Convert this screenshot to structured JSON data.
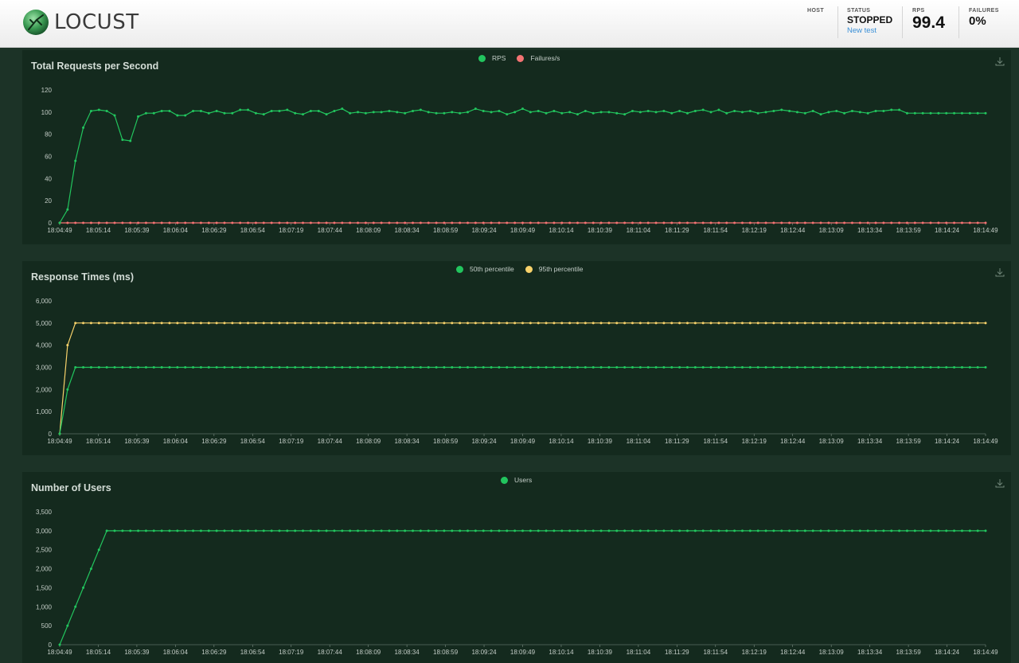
{
  "header": {
    "logo_text": "LOCUST",
    "host_label": "HOST",
    "status_label": "STATUS",
    "status_value": "STOPPED",
    "new_test_label": "New test",
    "rps_label": "RPS",
    "rps_value": "99.4",
    "failures_label": "FAILURES",
    "failures_value": "0%"
  },
  "colors": {
    "green": "#22c55e",
    "red": "#f47373",
    "yellow": "#f8d26b",
    "panel_bg": "#142a1e",
    "page_bg": "#1c3327"
  },
  "x_ticks": [
    "18:04:49",
    "18:05:14",
    "18:05:39",
    "18:06:04",
    "18:06:29",
    "18:06:54",
    "18:07:19",
    "18:07:44",
    "18:08:09",
    "18:08:34",
    "18:08:59",
    "18:09:24",
    "18:09:49",
    "18:10:14",
    "18:10:39",
    "18:11:04",
    "18:11:29",
    "18:11:54",
    "18:12:19",
    "18:12:44",
    "18:13:09",
    "18:13:34",
    "18:13:59",
    "18:14:24",
    "18:14:49"
  ],
  "chart_data": [
    {
      "type": "line",
      "title": "Total Requests per Second",
      "legend_placement": "top-center",
      "ylim": [
        0,
        120
      ],
      "yticks": [
        "0",
        "20",
        "40",
        "60",
        "80",
        "100",
        "120"
      ],
      "series": [
        {
          "name": "RPS",
          "color": "#22c55e",
          "values": [
            0,
            12,
            56,
            86,
            101,
            102,
            101,
            97,
            75,
            74,
            96,
            99,
            99,
            101,
            101,
            97,
            97,
            101,
            101,
            99,
            101,
            99,
            99,
            102,
            102,
            99,
            98,
            101,
            101,
            102,
            99,
            98,
            101,
            101,
            98,
            101,
            103,
            99,
            100,
            99,
            100,
            100,
            101,
            100,
            99,
            101,
            102,
            100,
            99,
            99,
            100,
            99,
            100,
            103,
            101,
            100,
            101,
            98,
            100,
            103,
            100,
            101,
            99,
            101,
            99,
            100,
            98,
            101,
            99,
            100,
            100,
            99,
            98,
            101,
            100,
            101,
            100,
            101,
            99,
            101,
            99,
            101,
            102,
            100,
            102,
            99,
            101,
            100,
            101,
            99,
            100,
            101,
            102,
            101,
            100,
            99,
            101,
            98,
            100,
            101,
            99,
            101,
            100,
            99,
            101,
            101,
            102,
            102,
            99
          ]
        },
        {
          "name": "Failures/s",
          "color": "#f47373",
          "values": "zeros"
        }
      ]
    },
    {
      "type": "line",
      "title": "Response Times (ms)",
      "legend_placement": "top-center",
      "ylim": [
        0,
        6000
      ],
      "yticks": [
        "0",
        "1,000",
        "2,000",
        "3,000",
        "4,000",
        "5,000",
        "6,000"
      ],
      "series": [
        {
          "name": "50th percentile",
          "color": "#22c55e",
          "start": [
            0,
            2000
          ],
          "steady": 3000
        },
        {
          "name": "95th percentile",
          "color": "#f8d26b",
          "start": [
            0,
            4000
          ],
          "steady": 5000
        }
      ]
    },
    {
      "type": "line",
      "title": "Number of Users",
      "legend_placement": "top-center",
      "ylim": [
        0,
        3500
      ],
      "yticks": [
        "0",
        "500",
        "1,000",
        "1,500",
        "2,000",
        "2,500",
        "3,000",
        "3,500"
      ],
      "series": [
        {
          "name": "Users",
          "color": "#22c55e",
          "start": [
            0,
            500,
            1000,
            1500,
            2000,
            2500
          ],
          "steady": 3000
        }
      ]
    }
  ]
}
